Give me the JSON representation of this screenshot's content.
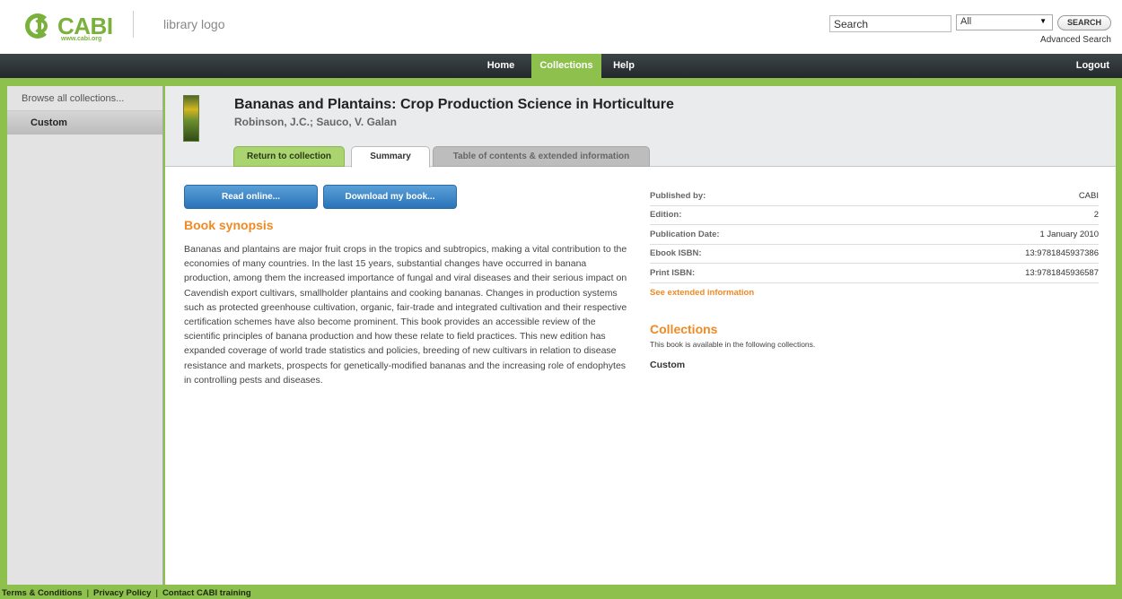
{
  "header": {
    "logo_text": "CABI",
    "logo_url_text": "www.cabi.org",
    "library_logo": "library logo",
    "search_placeholder": "Search",
    "search_scope": "All",
    "search_button": "SEARCH",
    "advanced_search": "Advanced Search"
  },
  "nav": {
    "home": "Home",
    "collections": "Collections",
    "help": "Help",
    "logout": "Logout"
  },
  "sidebar": {
    "header": "Browse all collections...",
    "items": [
      {
        "label": "Custom"
      }
    ]
  },
  "book": {
    "title": "Bananas and Plantains: Crop Production Science in Horticulture",
    "authors": "Robinson, J.C.; Sauco, V. Galan"
  },
  "tabs": {
    "return": "Return to collection",
    "summary": "Summary",
    "toc": "Table of contents & extended information"
  },
  "actions": {
    "read_online": "Read online...",
    "download": "Download my book..."
  },
  "synopsis": {
    "title": "Book synopsis",
    "text": "Bananas and plantains are major fruit crops in the tropics and subtropics, making a vital contribution to the economies of many countries. In the last 15 years, substantial changes have occurred in banana production, among them the increased importance of fungal and viral diseases and their serious impact on Cavendish export cultivars, smallholder plantains and cooking bananas. Changes in production systems such as protected greenhouse cultivation, organic, fair-trade and integrated cultivation and their respective certification schemes have also become prominent. This book provides an accessible review of the scientific principles of banana production and how these relate to field practices. This new edition has expanded coverage of world trade statistics and policies, breeding of new cultivars in relation to disease resistance and markets, prospects for genetically-modified bananas and the increasing role of endophytes in controlling pests and diseases."
  },
  "meta": {
    "rows": [
      {
        "label": "Published by:",
        "value": "CABI"
      },
      {
        "label": "Edition:",
        "value": "2"
      },
      {
        "label": "Publication Date:",
        "value": "1 January 2010"
      },
      {
        "label": "Ebook ISBN:",
        "value": "13:9781845937386"
      },
      {
        "label": "Print ISBN:",
        "value": "13:9781845936587"
      }
    ],
    "extended_link": "See extended information"
  },
  "collections": {
    "title": "Collections",
    "description": "This book is available in the following collections.",
    "item": "Custom"
  },
  "footer": {
    "terms": "Terms & Conditions",
    "privacy": "Privacy Policy",
    "contact": "Contact CABI training",
    "separator": "|"
  }
}
